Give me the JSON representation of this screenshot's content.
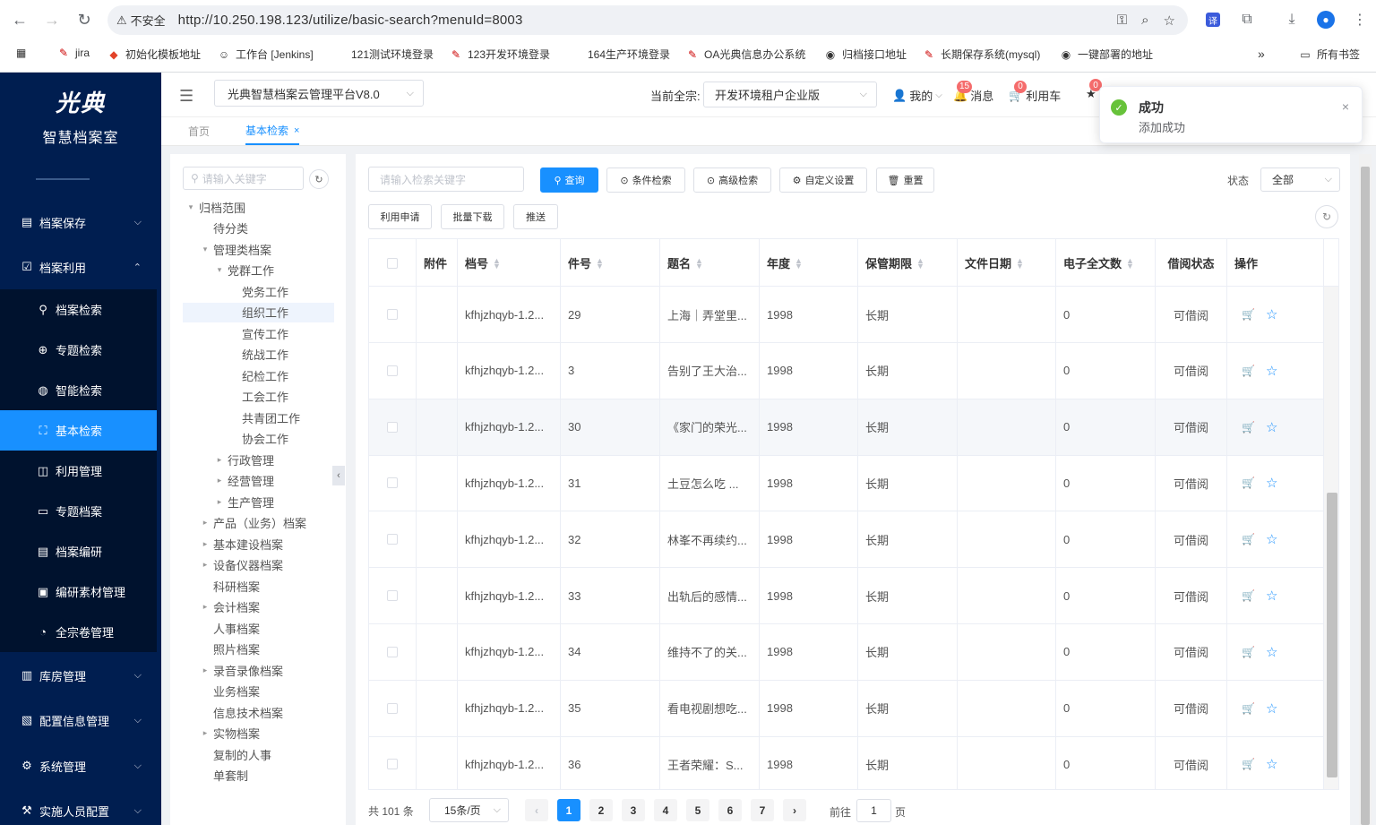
{
  "browser": {
    "security_label": "不安全",
    "url": "http://10.250.198.123/utilize/basic-search?menuId=8003",
    "bookmarks": [
      "jira",
      "初始化模板地址",
      "工作台 [Jenkins]",
      "121测试环境登录",
      "123开发环境登录",
      "164生产环境登录",
      "OA光典信息办公系统",
      "归档接口地址",
      "长期保存系统(mysql)",
      "一键部署的地址"
    ],
    "more": "»",
    "all_bookmarks": "所有书签"
  },
  "sidebar": {
    "logo_text": "光典",
    "subtitle": "智慧档案室",
    "menu": [
      {
        "label": "档案保存",
        "icon": "archive-icon",
        "expanded": false
      },
      {
        "label": "档案利用",
        "icon": "check-square-icon",
        "expanded": true
      },
      {
        "label": "库房管理",
        "icon": "warehouse-icon",
        "expanded": false
      },
      {
        "label": "配置信息管理",
        "icon": "clipboard-icon",
        "expanded": false
      },
      {
        "label": "系统管理",
        "icon": "gear-icon",
        "expanded": false
      },
      {
        "label": "实施人员配置",
        "icon": "wrench-icon",
        "expanded": false
      }
    ],
    "submenu": [
      {
        "label": "档案检索",
        "icon": "search-icon"
      },
      {
        "label": "专题检索",
        "icon": "compass-icon"
      },
      {
        "label": "智能检索",
        "icon": "globe-icon"
      },
      {
        "label": "基本检索",
        "icon": "scan-icon",
        "active": true
      },
      {
        "label": "利用管理",
        "icon": "book-icon"
      },
      {
        "label": "专题档案",
        "icon": "folder-icon"
      },
      {
        "label": "档案编研",
        "icon": "document-icon"
      },
      {
        "label": "编研素材管理",
        "icon": "material-icon"
      },
      {
        "label": "全宗卷管理",
        "icon": "dashboard-icon"
      }
    ]
  },
  "topbar": {
    "system": "光典智慧档案云管理平台V8.0",
    "current_fonds_label": "当前全宗:",
    "tenant": "开发环境租户企业版",
    "mine": "我的",
    "messages": "消息",
    "messages_count": "15",
    "cart": "利用车",
    "cart_count": "0",
    "fav_count": "0"
  },
  "tabs": [
    {
      "label": "首页"
    },
    {
      "label": "基本检索",
      "close": "×"
    }
  ],
  "tree": {
    "search_placeholder": "请输入关键字",
    "nodes": [
      {
        "label": "归档范围",
        "level": 0,
        "toggle": "▾"
      },
      {
        "label": "待分类",
        "level": 1,
        "toggle": ""
      },
      {
        "label": "管理类档案",
        "level": 1,
        "toggle": "▾"
      },
      {
        "label": "党群工作",
        "level": 2,
        "toggle": "▾"
      },
      {
        "label": "党务工作",
        "level": 3,
        "toggle": ""
      },
      {
        "label": "组织工作",
        "level": 3,
        "toggle": "",
        "selected": true
      },
      {
        "label": "宣传工作",
        "level": 3,
        "toggle": ""
      },
      {
        "label": "统战工作",
        "level": 3,
        "toggle": ""
      },
      {
        "label": "纪检工作",
        "level": 3,
        "toggle": ""
      },
      {
        "label": "工会工作",
        "level": 3,
        "toggle": ""
      },
      {
        "label": "共青团工作",
        "level": 3,
        "toggle": ""
      },
      {
        "label": "协会工作",
        "level": 3,
        "toggle": ""
      },
      {
        "label": "行政管理",
        "level": 2,
        "toggle": "▸"
      },
      {
        "label": "经营管理",
        "level": 2,
        "toggle": "▸"
      },
      {
        "label": "生产管理",
        "level": 2,
        "toggle": "▸"
      },
      {
        "label": "产品（业务）档案",
        "level": 1,
        "toggle": "▸"
      },
      {
        "label": "基本建设档案",
        "level": 1,
        "toggle": "▸"
      },
      {
        "label": "设备仪器档案",
        "level": 1,
        "toggle": "▸"
      },
      {
        "label": "科研档案",
        "level": 1,
        "toggle": ""
      },
      {
        "label": "会计档案",
        "level": 1,
        "toggle": "▸"
      },
      {
        "label": "人事档案",
        "level": 1,
        "toggle": ""
      },
      {
        "label": "照片档案",
        "level": 1,
        "toggle": ""
      },
      {
        "label": "录音录像档案",
        "level": 1,
        "toggle": "▸"
      },
      {
        "label": "业务档案",
        "level": 1,
        "toggle": ""
      },
      {
        "label": "信息技术档案",
        "level": 1,
        "toggle": ""
      },
      {
        "label": "实物档案",
        "level": 1,
        "toggle": "▸"
      },
      {
        "label": "复制的人事",
        "level": 1,
        "toggle": ""
      },
      {
        "label": "单套制",
        "level": 1,
        "toggle": ""
      }
    ]
  },
  "search": {
    "placeholder": "请输入检索关键字",
    "query": "查询",
    "condition": "条件检索",
    "advanced": "高级检索",
    "custom": "自定义设置",
    "reset": "重置",
    "status_label": "状态",
    "status_value": "全部",
    "apply": "利用申请",
    "batch_download": "批量下载",
    "push": "推送"
  },
  "table": {
    "headers": [
      "附件",
      "档号",
      "件号",
      "题名",
      "年度",
      "保管期限",
      "文件日期",
      "电子全文数",
      "借阅状态",
      "操作"
    ],
    "rows": [
      {
        "code": "kfhjzhqyb-1.2...",
        "num": "29",
        "title": "上海｜弄堂里...",
        "year": "1998",
        "period": "长期",
        "date": "",
        "count": "0",
        "status": "可借阅"
      },
      {
        "code": "kfhjzhqyb-1.2...",
        "num": "3",
        "title": "告别了王大治...",
        "year": "1998",
        "period": "长期",
        "date": "",
        "count": "0",
        "status": "可借阅"
      },
      {
        "code": "kfhjzhqyb-1.2...",
        "num": "30",
        "title": "《家门的荣光...",
        "year": "1998",
        "period": "长期",
        "date": "",
        "count": "0",
        "status": "可借阅"
      },
      {
        "code": "kfhjzhqyb-1.2...",
        "num": "31",
        "title": "土豆怎么吃 ...",
        "year": "1998",
        "period": "长期",
        "date": "",
        "count": "0",
        "status": "可借阅"
      },
      {
        "code": "kfhjzhqyb-1.2...",
        "num": "32",
        "title": "林峯不再续约...",
        "year": "1998",
        "period": "长期",
        "date": "",
        "count": "0",
        "status": "可借阅"
      },
      {
        "code": "kfhjzhqyb-1.2...",
        "num": "33",
        "title": "出轨后的感情...",
        "year": "1998",
        "period": "长期",
        "date": "",
        "count": "0",
        "status": "可借阅"
      },
      {
        "code": "kfhjzhqyb-1.2...",
        "num": "34",
        "title": "维持不了的关...",
        "year": "1998",
        "period": "长期",
        "date": "",
        "count": "0",
        "status": "可借阅"
      },
      {
        "code": "kfhjzhqyb-1.2...",
        "num": "35",
        "title": "看电视剧想吃...",
        "year": "1998",
        "period": "长期",
        "date": "",
        "count": "0",
        "status": "可借阅"
      },
      {
        "code": "kfhjzhqyb-1.2...",
        "num": "36",
        "title": "王者荣耀：S...",
        "year": "1998",
        "period": "长期",
        "date": "",
        "count": "0",
        "status": "可借阅"
      }
    ]
  },
  "pagination": {
    "total": "共 101 条",
    "page_size": "15条/页",
    "pages": [
      "1",
      "2",
      "3",
      "4",
      "5",
      "6",
      "7"
    ],
    "prev": "‹",
    "next": "›",
    "goto_label": "前往",
    "goto_value": "1",
    "page_unit": "页"
  },
  "toast": {
    "title": "成功",
    "message": "添加成功",
    "close": "×"
  }
}
